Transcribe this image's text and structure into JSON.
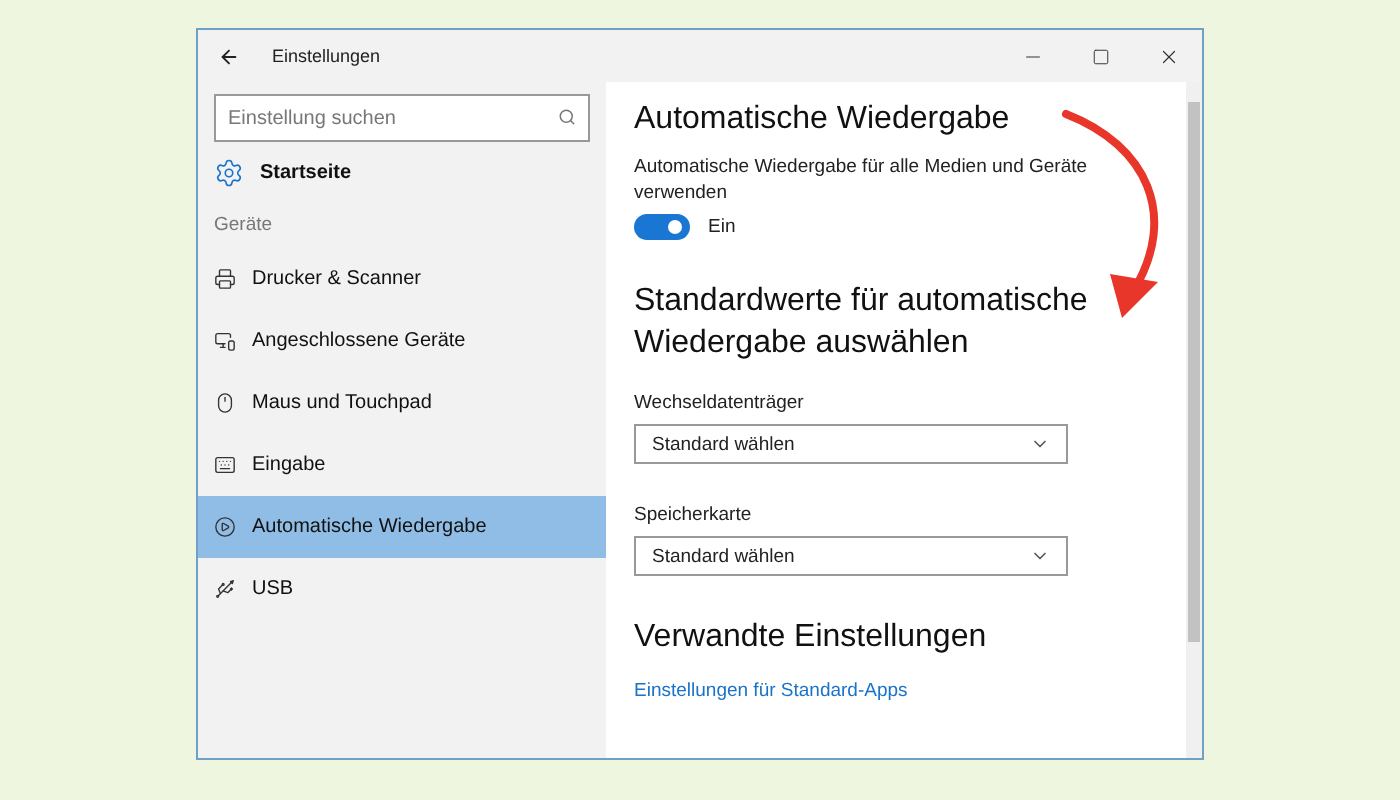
{
  "window": {
    "title": "Einstellungen"
  },
  "sidebar": {
    "search": {
      "placeholder": "Einstellung suchen"
    },
    "home": "Startseite",
    "section": "Geräte",
    "items": [
      {
        "label": "Drucker & Scanner",
        "selected": false
      },
      {
        "label": "Angeschlossene Geräte",
        "selected": false
      },
      {
        "label": "Maus und Touchpad",
        "selected": false
      },
      {
        "label": "Eingabe",
        "selected": false
      },
      {
        "label": "Automatische Wiedergabe",
        "selected": true
      },
      {
        "label": "USB",
        "selected": false
      }
    ]
  },
  "content": {
    "title": "Automatische Wiedergabe",
    "description": "Automatische Wiedergabe für alle Medien und Geräte verwenden",
    "toggle": {
      "on": true,
      "label": "Ein"
    },
    "defaults_heading": "Standardwerte für automatische Wiedergabe auswählen",
    "dropdowns": [
      {
        "label": "Wechseldatenträger",
        "value": "Standard wählen"
      },
      {
        "label": "Speicherkarte",
        "value": "Standard wählen"
      }
    ],
    "related_heading": "Verwandte Einstellungen",
    "link": "Einstellungen für Standard-Apps"
  }
}
